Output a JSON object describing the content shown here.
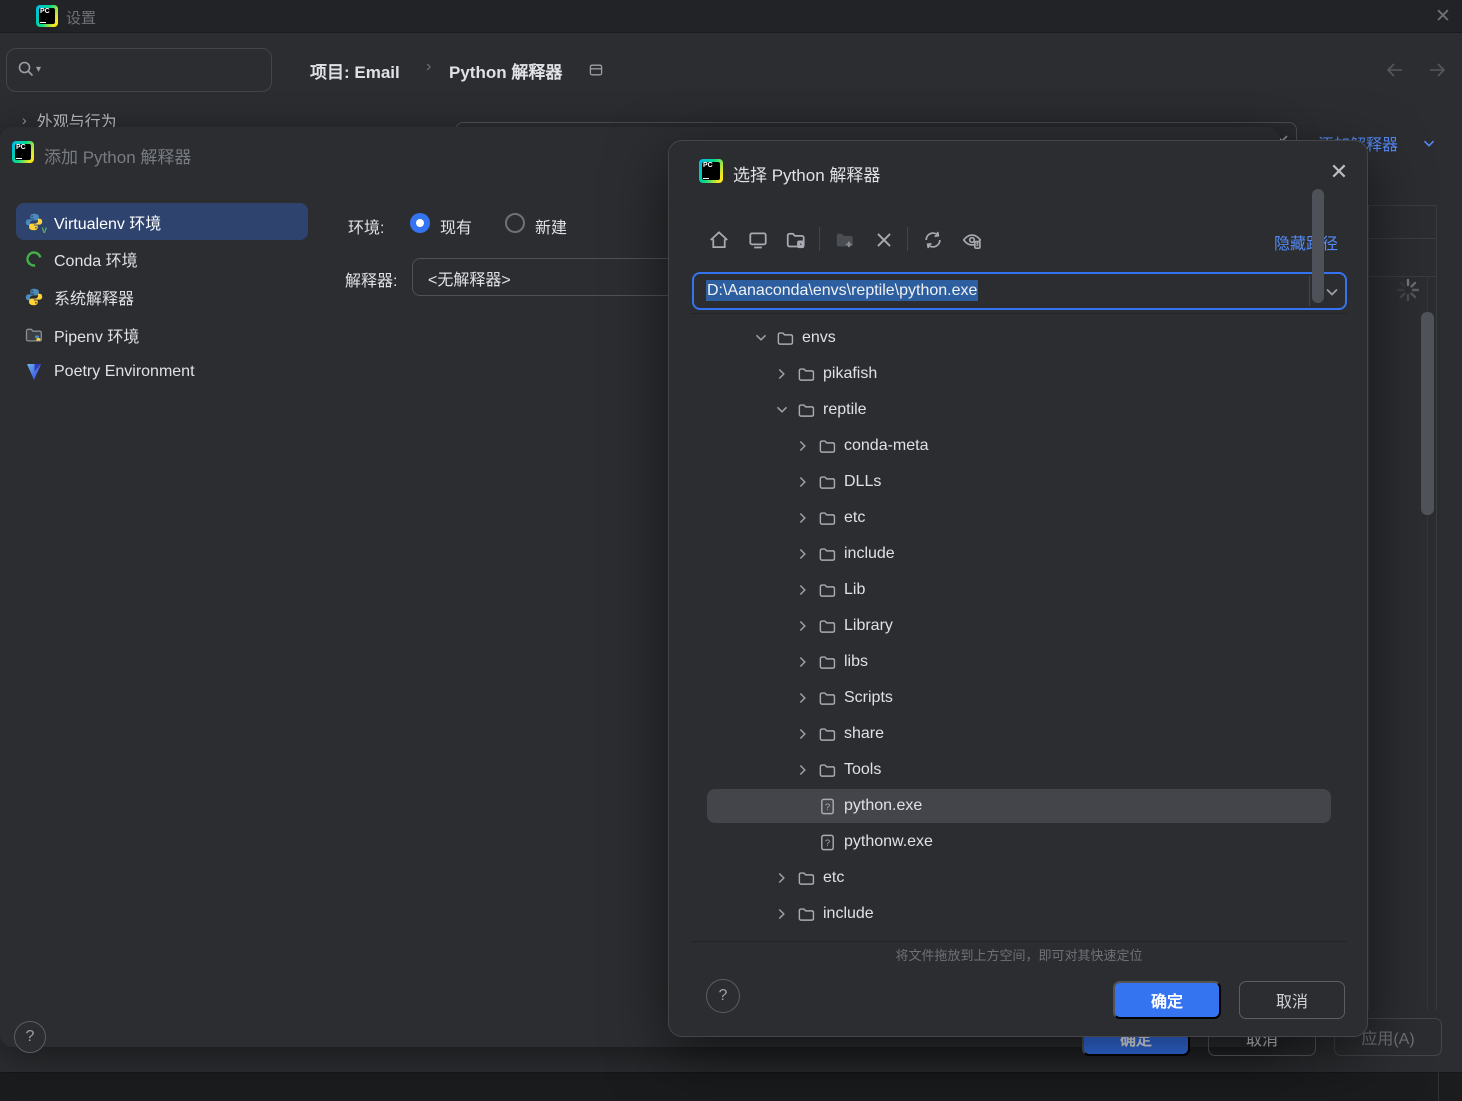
{
  "app": {
    "logo_text": "PC"
  },
  "colors": {
    "bg": "#2b2d30",
    "bgdark": "#222326",
    "border": "#43454a",
    "borderlight": "#4e5157",
    "accent": "#3574f0",
    "link": "#548af7",
    "selside": "#2e436e",
    "seltree": "#43454a",
    "text": "#dfe1e5",
    "textdim": "#9da0a8",
    "textfaint": "#6e7177",
    "disabled": "#5a5d63",
    "inputsel": "#2d5fa0"
  },
  "settings_window": {
    "title": "设置",
    "search_placeholder": "",
    "breadcrumb": {
      "project": "项目: Email",
      "separator": "›",
      "page": "Python 解释器"
    },
    "nav_tree_item_chevron": "›",
    "nav_tree_item": "外观与行为",
    "add_interpreter_link": "添加解释器",
    "buttons": {
      "ok": "确定",
      "cancel": "取消",
      "apply": "应用(A)",
      "help": "?"
    }
  },
  "add_dialog": {
    "title": "添加 Python 解释器",
    "sidebar": [
      {
        "label": "Virtualenv 环境",
        "icon": "virtualenv-icon",
        "selected": true
      },
      {
        "label": "Conda 环境",
        "icon": "conda-icon",
        "selected": false
      },
      {
        "label": "系统解释器",
        "icon": "python-icon",
        "selected": false
      },
      {
        "label": "Pipenv 环境",
        "icon": "pipenv-icon",
        "selected": false
      },
      {
        "label": "Poetry Environment",
        "icon": "poetry-icon",
        "selected": false
      }
    ],
    "env_label": "环境:",
    "radio_existing": "现有",
    "radio_new": "新建",
    "radio_selected": "现有",
    "interpreter_label": "解释器:",
    "interpreter_value": "<无解释器>",
    "help": "?"
  },
  "select_dialog": {
    "title": "选择 Python 解释器",
    "close": "✕",
    "toolbar_icons": [
      "home-icon",
      "desktop-icon",
      "folder-settings-icon",
      "new-folder-icon",
      "delete-icon",
      "refresh-icon",
      "show-hidden-files-icon"
    ],
    "hide_path_link": "隐藏路径",
    "path_value": "D:\\Aanaconda\\envs\\reptile\\python.exe",
    "tree": {
      "rows": [
        {
          "label": "envs",
          "level": 0,
          "kind": "folder",
          "state": "expanded"
        },
        {
          "label": "pikafish",
          "level": 1,
          "kind": "folder",
          "state": "collapsed"
        },
        {
          "label": "reptile",
          "level": 1,
          "kind": "folder",
          "state": "expanded"
        },
        {
          "label": "conda-meta",
          "level": 2,
          "kind": "folder",
          "state": "collapsed"
        },
        {
          "label": "DLLs",
          "level": 2,
          "kind": "folder",
          "state": "collapsed"
        },
        {
          "label": "etc",
          "level": 2,
          "kind": "folder",
          "state": "collapsed"
        },
        {
          "label": "include",
          "level": 2,
          "kind": "folder",
          "state": "collapsed"
        },
        {
          "label": "Lib",
          "level": 2,
          "kind": "folder",
          "state": "collapsed"
        },
        {
          "label": "Library",
          "level": 2,
          "kind": "folder",
          "state": "collapsed"
        },
        {
          "label": "libs",
          "level": 2,
          "kind": "folder",
          "state": "collapsed"
        },
        {
          "label": "Scripts",
          "level": 2,
          "kind": "folder",
          "state": "collapsed"
        },
        {
          "label": "share",
          "level": 2,
          "kind": "folder",
          "state": "collapsed"
        },
        {
          "label": "Tools",
          "level": 2,
          "kind": "folder",
          "state": "collapsed"
        },
        {
          "label": "python.exe",
          "level": 2,
          "kind": "file",
          "state": "none",
          "selected": true
        },
        {
          "label": "pythonw.exe",
          "level": 2,
          "kind": "file",
          "state": "none"
        },
        {
          "label": "etc",
          "level": 1,
          "kind": "folder",
          "state": "collapsed"
        },
        {
          "label": "include",
          "level": 1,
          "kind": "folder",
          "state": "collapsed"
        },
        {
          "label": "",
          "level": 1,
          "kind": "folder",
          "state": "collapsed",
          "partial": true
        }
      ]
    },
    "hint": "将文件拖放到上方空间，即可对其快速定位",
    "buttons": {
      "ok": "确定",
      "cancel": "取消",
      "help": "?"
    }
  }
}
